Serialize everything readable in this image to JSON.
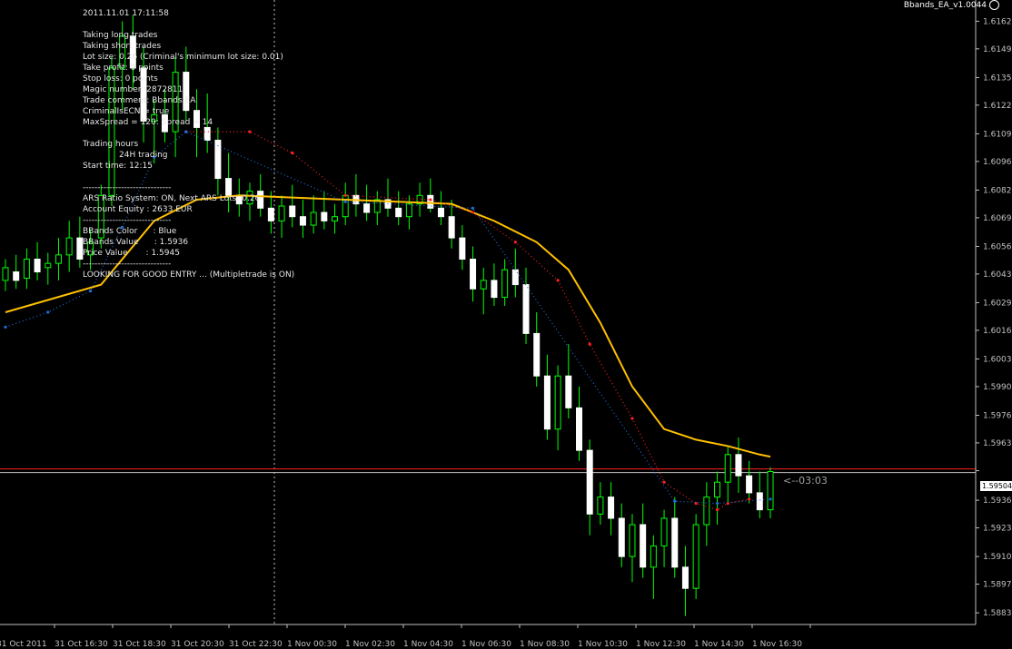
{
  "window": {
    "ea_label": "Bbands_EA_v1.0044",
    "countdown": "<--03:03",
    "current_price": "1.59504"
  },
  "info_lines": [
    "2011.11.01 17:11:58",
    "",
    "Taking long trades",
    "Taking short trades",
    "Lot size: 0.26 (Criminal's minimum lot size: 0.01)",
    "Take profit: 0 points",
    "Stop loss: 0 points",
    "Magic number: 2872811",
    "Trade comment: Bbands EA",
    "CriminalIsECN = true",
    "MaxSpread = 120: Spread = 14",
    "",
    "Trading hours",
    "              24H trading",
    "Start time: 12:15",
    "",
    "------------------------------",
    "ARS Ratio System: ON, Next ARS Lots: 0.26",
    "Account Equity : 2633 EUR",
    "------------------------------",
    "BBands Color      : Blue",
    "BBands Value      : 1.5936",
    "Price Value       : 1.5945",
    "------------------------------",
    "LOOKING FOR GOOD ENTRY ... (Multipletrade is ON)"
  ],
  "chart_data": {
    "type": "line",
    "y_ticks": [
      "1.61620",
      "1.61490",
      "1.61355",
      "1.61225",
      "1.61090",
      "1.60960",
      "1.60825",
      "1.60695",
      "1.60560",
      "1.60430",
      "1.60295",
      "1.60165",
      "1.60030",
      "1.59900",
      "1.59765",
      "1.59635",
      "1.59504",
      "1.59365",
      "1.59235",
      "1.59100",
      "1.58970",
      "1.58835"
    ],
    "x_ticks": [
      "31 Oct 2011",
      "31 Oct 16:30",
      "31 Oct 18:30",
      "31 Oct 20:30",
      "31 Oct 22:30",
      "1 Nov 00:30",
      "1 Nov 02:30",
      "1 Nov 04:30",
      "1 Nov 06:30",
      "1 Nov 08:30",
      "1 Nov 10:30",
      "1 Nov 12:30",
      "1 Nov 14:30",
      "1 Nov 16:30"
    ],
    "ylim": [
      1.5878,
      1.6172
    ],
    "current_price": 1.59504,
    "candles": [
      [
        1.604,
        1.605,
        1.6035,
        1.6046
      ],
      [
        1.6044,
        1.6052,
        1.6036,
        1.604
      ],
      [
        1.6041,
        1.6055,
        1.6036,
        1.605
      ],
      [
        1.605,
        1.6058,
        1.604,
        1.6044
      ],
      [
        1.6046,
        1.6053,
        1.6038,
        1.6048
      ],
      [
        1.6048,
        1.606,
        1.604,
        1.6052
      ],
      [
        1.6052,
        1.6068,
        1.6044,
        1.606
      ],
      [
        1.606,
        1.607,
        1.6046,
        1.605
      ],
      [
        1.6052,
        1.6064,
        1.6045,
        1.6058
      ],
      [
        1.606,
        1.6085,
        1.6055,
        1.608
      ],
      [
        1.608,
        1.6145,
        1.6075,
        1.614
      ],
      [
        1.614,
        1.6162,
        1.612,
        1.6155
      ],
      [
        1.6155,
        1.6165,
        1.613,
        1.614
      ],
      [
        1.614,
        1.615,
        1.6105,
        1.6115
      ],
      [
        1.6115,
        1.6125,
        1.6095,
        1.6118
      ],
      [
        1.6118,
        1.613,
        1.6105,
        1.611
      ],
      [
        1.611,
        1.6145,
        1.6098,
        1.6138
      ],
      [
        1.6138,
        1.615,
        1.6115,
        1.612
      ],
      [
        1.612,
        1.613,
        1.6098,
        1.6112
      ],
      [
        1.6112,
        1.6128,
        1.61,
        1.6106
      ],
      [
        1.6106,
        1.6112,
        1.608,
        1.6088
      ],
      [
        1.6088,
        1.61,
        1.6072,
        1.608
      ],
      [
        1.608,
        1.6088,
        1.607,
        1.6076
      ],
      [
        1.6076,
        1.6086,
        1.6068,
        1.6082
      ],
      [
        1.6082,
        1.609,
        1.607,
        1.6074
      ],
      [
        1.6074,
        1.6082,
        1.6062,
        1.6068
      ],
      [
        1.6068,
        1.608,
        1.606,
        1.6075
      ],
      [
        1.6075,
        1.6085,
        1.6065,
        1.607
      ],
      [
        1.607,
        1.6078,
        1.606,
        1.6066
      ],
      [
        1.6066,
        1.608,
        1.6062,
        1.6072
      ],
      [
        1.6072,
        1.6082,
        1.6064,
        1.6068
      ],
      [
        1.6068,
        1.6076,
        1.6062,
        1.607
      ],
      [
        1.607,
        1.6086,
        1.6066,
        1.608
      ],
      [
        1.608,
        1.609,
        1.607,
        1.6076
      ],
      [
        1.6076,
        1.6085,
        1.6068,
        1.6072
      ],
      [
        1.6072,
        1.6082,
        1.6066,
        1.6078
      ],
      [
        1.6078,
        1.6088,
        1.607,
        1.6074
      ],
      [
        1.6074,
        1.6082,
        1.6066,
        1.607
      ],
      [
        1.607,
        1.608,
        1.6064,
        1.6076
      ],
      [
        1.6076,
        1.6086,
        1.607,
        1.608
      ],
      [
        1.608,
        1.6088,
        1.6072,
        1.6074
      ],
      [
        1.6074,
        1.6082,
        1.6066,
        1.607
      ],
      [
        1.607,
        1.6078,
        1.6055,
        1.606
      ],
      [
        1.606,
        1.6066,
        1.6045,
        1.605
      ],
      [
        1.605,
        1.6056,
        1.603,
        1.6036
      ],
      [
        1.6036,
        1.6046,
        1.6024,
        1.604
      ],
      [
        1.604,
        1.6048,
        1.6028,
        1.6032
      ],
      [
        1.6032,
        1.605,
        1.6028,
        1.6045
      ],
      [
        1.6045,
        1.6055,
        1.6032,
        1.6038
      ],
      [
        1.6038,
        1.6046,
        1.601,
        1.6015
      ],
      [
        1.6015,
        1.6025,
        1.599,
        1.5995
      ],
      [
        1.5995,
        1.6005,
        1.5965,
        1.597
      ],
      [
        1.597,
        1.6,
        1.596,
        1.5995
      ],
      [
        1.5995,
        1.601,
        1.5975,
        1.598
      ],
      [
        1.598,
        1.599,
        1.5955,
        1.596
      ],
      [
        1.596,
        1.5965,
        1.592,
        1.593
      ],
      [
        1.593,
        1.5945,
        1.5925,
        1.5938
      ],
      [
        1.5938,
        1.5945,
        1.592,
        1.5928
      ],
      [
        1.5928,
        1.5935,
        1.5905,
        1.591
      ],
      [
        1.591,
        1.593,
        1.5898,
        1.5925
      ],
      [
        1.5925,
        1.5935,
        1.59,
        1.5905
      ],
      [
        1.5905,
        1.592,
        1.589,
        1.5915
      ],
      [
        1.5915,
        1.5932,
        1.5905,
        1.5928
      ],
      [
        1.5928,
        1.5938,
        1.59,
        1.5905
      ],
      [
        1.5905,
        1.5915,
        1.5882,
        1.5895
      ],
      [
        1.5895,
        1.593,
        1.589,
        1.5925
      ],
      [
        1.5925,
        1.5945,
        1.5915,
        1.5938
      ],
      [
        1.5938,
        1.595,
        1.5925,
        1.5945
      ],
      [
        1.5945,
        1.5962,
        1.5935,
        1.5958
      ],
      [
        1.5958,
        1.5966,
        1.594,
        1.5948
      ],
      [
        1.5948,
        1.5955,
        1.5935,
        1.594
      ],
      [
        1.594,
        1.595,
        1.5928,
        1.5932
      ],
      [
        1.5932,
        1.5952,
        1.5928,
        1.595
      ]
    ],
    "series": [
      {
        "color": "#ffc000",
        "points": [
          [
            0,
            1.6025
          ],
          [
            9,
            1.6038
          ],
          [
            14,
            1.6068
          ],
          [
            18,
            1.6078
          ],
          [
            22,
            1.608
          ],
          [
            32,
            1.6078
          ],
          [
            42,
            1.6076
          ],
          [
            46,
            1.6068
          ],
          [
            50,
            1.6058
          ],
          [
            53,
            1.6045
          ],
          [
            56,
            1.602
          ],
          [
            59,
            1.599
          ],
          [
            62,
            1.597
          ],
          [
            65,
            1.5965
          ],
          [
            68,
            1.5962
          ],
          [
            71,
            1.5958
          ],
          [
            72,
            1.5957
          ]
        ]
      },
      {
        "color": "#ff2020",
        "points": [
          [
            17,
            1.611
          ],
          [
            23,
            1.611
          ],
          [
            27,
            1.61
          ],
          [
            32,
            1.608
          ],
          [
            40,
            1.6078
          ],
          [
            44,
            1.6072
          ],
          [
            48,
            1.6058
          ],
          [
            52,
            1.604
          ],
          [
            55,
            1.601
          ],
          [
            59,
            1.5975
          ],
          [
            62,
            1.5945
          ],
          [
            65,
            1.5935
          ],
          [
            67,
            1.5932
          ],
          [
            68,
            1.5935
          ],
          [
            70,
            1.5937
          ]
        ]
      },
      {
        "color": "#1e6edc",
        "points": [
          [
            0,
            1.6018
          ],
          [
            4,
            1.6025
          ],
          [
            8,
            1.6035
          ],
          [
            11,
            1.6065
          ],
          [
            14,
            1.6098
          ],
          [
            17,
            1.611
          ],
          [
            32,
            1.6077
          ],
          [
            44,
            1.6074
          ],
          [
            63,
            1.5936
          ],
          [
            67,
            1.5935
          ],
          [
            72,
            1.5937
          ]
        ]
      }
    ]
  }
}
